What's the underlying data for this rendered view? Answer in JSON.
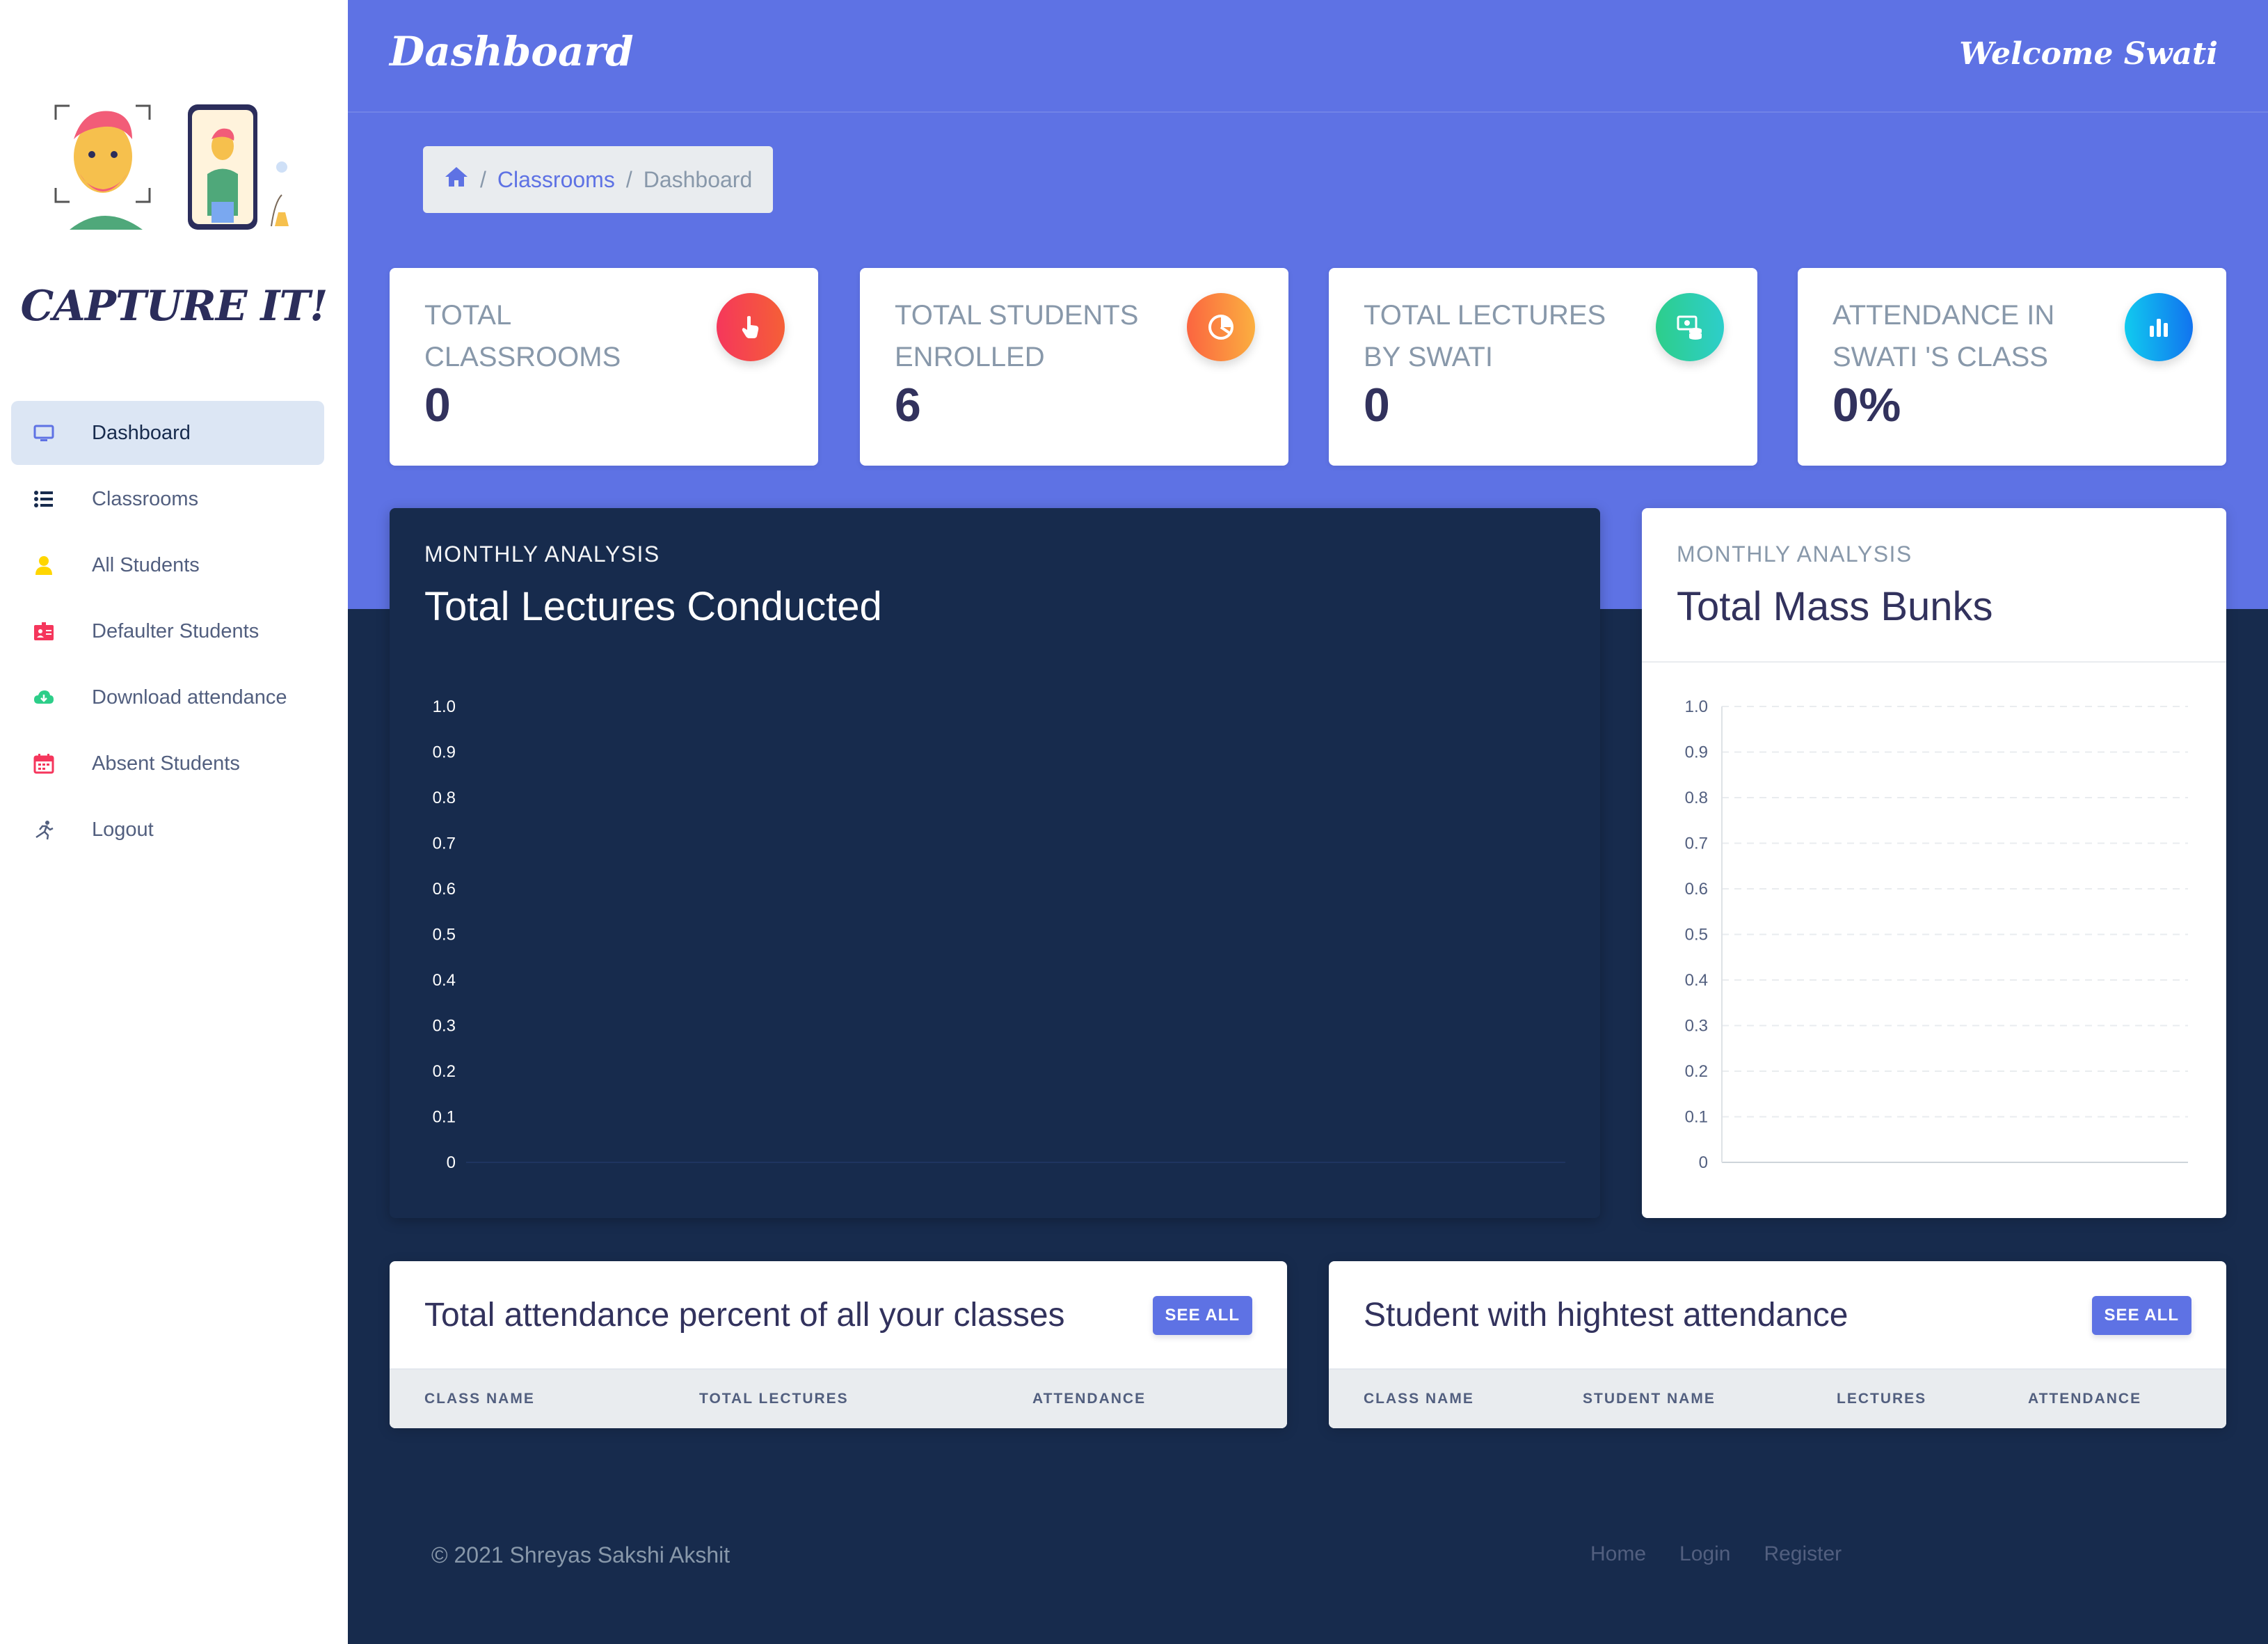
{
  "sidebar": {
    "brand": "CAPTURE IT!",
    "items": [
      {
        "label": "Dashboard",
        "icon": "monitor-icon",
        "color": "#5e72e4",
        "active": true
      },
      {
        "label": "Classrooms",
        "icon": "list-icon",
        "color": "#172b4d"
      },
      {
        "label": "All Students",
        "icon": "user-icon",
        "color": "#ffd600"
      },
      {
        "label": "Defaulter Students",
        "icon": "id-card-icon",
        "color": "#f5365c"
      },
      {
        "label": "Download attendance",
        "icon": "cloud-download-icon",
        "color": "#2dce89"
      },
      {
        "label": "Absent Students",
        "icon": "calendar-icon",
        "color": "#f5365c"
      },
      {
        "label": "Logout",
        "icon": "running-icon",
        "color": "#525f7f"
      }
    ]
  },
  "header": {
    "title": "Dashboard",
    "welcome": "Welcome Swati",
    "breadcrumb": {
      "home_icon": "home-icon",
      "items": [
        "Classrooms",
        "Dashboard"
      ]
    }
  },
  "stats": [
    {
      "title": "TOTAL CLASSROOMS",
      "value": "0",
      "icon": "hand-pointer-icon",
      "color": "#f5365c"
    },
    {
      "title": "TOTAL STUDENTS ENROLLED",
      "value": "6",
      "icon": "pie-chart-icon",
      "color": "#fb6340"
    },
    {
      "title": "TOTAL LECTURES BY SWATI",
      "value": "0",
      "icon": "money-coins-icon",
      "color": "#2dce89"
    },
    {
      "title": "ATTENDANCE IN SWATI 'S CLASS",
      "value": "0%",
      "icon": "bar-chart-icon",
      "color": "#11cdef"
    }
  ],
  "charts": {
    "lectures": {
      "overline": "MONTHLY ANALYSIS",
      "title": "Total Lectures Conducted"
    },
    "bunks": {
      "overline": "MONTHLY ANALYSIS",
      "title": "Total Mass Bunks"
    }
  },
  "chart_data": [
    {
      "type": "bar",
      "title": "Total Lectures Conducted",
      "categories": [],
      "values": [],
      "ylim": [
        0,
        1
      ],
      "yticks": [
        "1.0",
        "0.9",
        "0.8",
        "0.7",
        "0.6",
        "0.5",
        "0.4",
        "0.3",
        "0.2",
        "0.1",
        "0"
      ],
      "grid": false
    },
    {
      "type": "bar",
      "title": "Total Mass Bunks",
      "categories": [],
      "values": [],
      "ylim": [
        0,
        1
      ],
      "yticks": [
        "1.0",
        "0.9",
        "0.8",
        "0.7",
        "0.6",
        "0.5",
        "0.4",
        "0.3",
        "0.2",
        "0.1",
        "0"
      ],
      "grid": true
    }
  ],
  "tables": {
    "classes": {
      "title": "Total attendance percent of all your classes",
      "button": "SEE ALL",
      "columns": [
        "CLASS NAME",
        "TOTAL LECTURES",
        "ATTENDANCE"
      ]
    },
    "top_student": {
      "title": "Student with hightest attendance",
      "button": "SEE ALL",
      "columns": [
        "CLASS NAME",
        "STUDENT NAME",
        "LECTURES",
        "ATTENDANCE"
      ]
    }
  },
  "footer": {
    "copyright": "© 2021 Shreyas Sakshi Akshit",
    "links": [
      "Home",
      "Login",
      "Register"
    ]
  }
}
